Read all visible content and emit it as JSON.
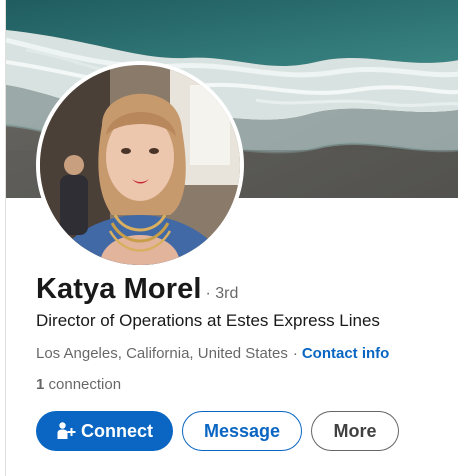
{
  "profile": {
    "name": "Katya Morel",
    "degree": "· 3rd",
    "headline": "Director of Operations at Estes Express Lines",
    "location": "Los Angeles, California, United States",
    "separator": "·",
    "contact_info_label": "Contact info",
    "connection_count": "1",
    "connection_label": " connection"
  },
  "actions": {
    "connect_label": "Connect",
    "message_label": "Message",
    "more_label": "More"
  },
  "icons": {
    "connect_icon": "person-add-icon"
  },
  "colors": {
    "accent": "#0a66c2",
    "banner_sea": "#2f6f6f",
    "banner_sand": "#5b5a56"
  }
}
